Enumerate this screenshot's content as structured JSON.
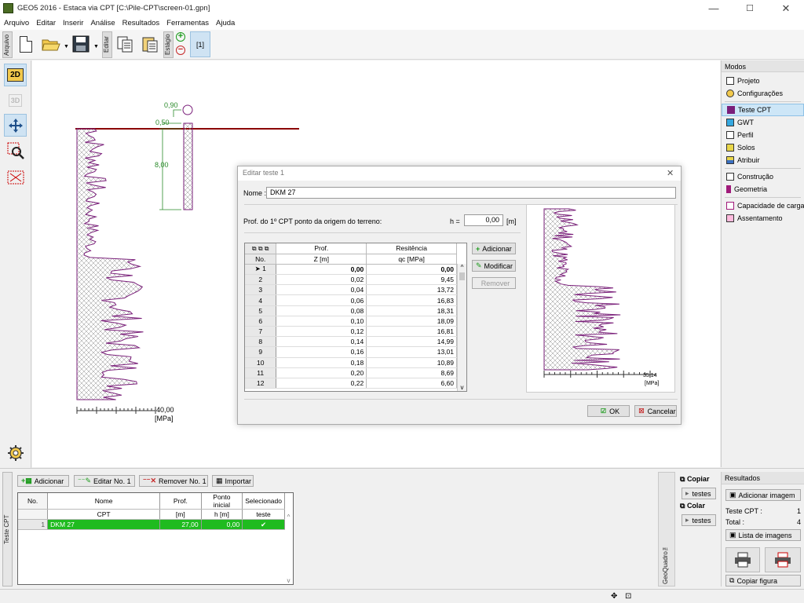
{
  "window": {
    "title": "GEO5 2016 - Estaca via CPT [C:\\Pile-CPT\\screen-01.gpn]",
    "minimize": "—",
    "maximize": "☐",
    "close": "✕"
  },
  "menu": [
    "Arquivo",
    "Editar",
    "Inserir",
    "Análise",
    "Resultados",
    "Ferramentas",
    "Ajuda"
  ],
  "toolbar": {
    "arquivo_tab": "Arquivo",
    "editar_tab": "Editar",
    "estagio_tab": "Estágio",
    "stage": "[1]"
  },
  "leftbar": {
    "btn_2d": "2D",
    "btn_3d": "3D"
  },
  "drawing": {
    "dim_top": "0,90",
    "dim_mid": "0,50",
    "dim_len": "8,00",
    "axis_value": "40,00",
    "axis_unit": "[MPa]"
  },
  "right_panel": {
    "header": "Modos",
    "items": [
      "Projeto",
      "Configurações",
      "Teste CPT",
      "GWT",
      "Perfil",
      "Solos",
      "Atribuir",
      "Construção",
      "Geometria",
      "Capacidade de carga",
      "Assentamento"
    ],
    "active_index": 2
  },
  "dialog": {
    "title": "Editar teste 1",
    "name_label": "Nome :",
    "name_value": "DKM 27",
    "prof_label": "Prof. do 1º CPT ponto da origem do terreno:",
    "h_label": "h =",
    "h_value": "0,00",
    "h_unit": "[m]",
    "col_no": "No.",
    "col_prof": "Prof.",
    "col_prof_unit": "Z [m]",
    "col_res": "Resitência",
    "col_res_unit": "qc [MPa]",
    "rows": [
      [
        "1",
        "0,00",
        "0,00"
      ],
      [
        "2",
        "0,02",
        "9,45"
      ],
      [
        "3",
        "0,04",
        "13,72"
      ],
      [
        "4",
        "0,06",
        "16,83"
      ],
      [
        "5",
        "0,08",
        "18,31"
      ],
      [
        "6",
        "0,10",
        "18,09"
      ],
      [
        "7",
        "0,12",
        "16,81"
      ],
      [
        "8",
        "0,14",
        "14,99"
      ],
      [
        "9",
        "0,16",
        "13,01"
      ],
      [
        "10",
        "0,18",
        "10,89"
      ],
      [
        "11",
        "0,20",
        "8,69"
      ],
      [
        "12",
        "0,22",
        "6,60"
      ]
    ],
    "btn_add": "Adicionar",
    "btn_modify": "Modificar",
    "btn_remove": "Remover",
    "preview_axis_value": "35,14",
    "preview_axis_unit": "[MPa]",
    "ok": "OK",
    "cancel": "Cancelar"
  },
  "bottom": {
    "side_tab": "Teste CPT",
    "btn_add": "Adicionar",
    "btn_edit": "Editar No. 1",
    "btn_remove": "Remover No. 1",
    "btn_import": "Importar",
    "headers": [
      [
        "No.",
        ""
      ],
      [
        "Nome",
        "CPT"
      ],
      [
        "Prof.",
        "[m]"
      ],
      [
        "Ponto inicial",
        "h [m]"
      ],
      [
        "Selecionado",
        "teste"
      ]
    ],
    "rows": [
      {
        "no": "1",
        "name": "DKM 27",
        "prof": "27,00",
        "h": "0,00",
        "selected": "✔"
      }
    ],
    "copy": "Copiar",
    "paste": "Colar",
    "tests": "testes",
    "geoquadro": "GeoQuadro™"
  },
  "results": {
    "header": "Resultados",
    "add_image": "Adicionar imagem",
    "teste_cpt_label": "Teste CPT :",
    "teste_cpt_value": "1",
    "total_label": "Total :",
    "total_value": "4",
    "image_list": "Lista de imagens",
    "copy_figure": "Copiar figura"
  },
  "colors": {
    "accent_green": "#1fbb1f",
    "soil_line": "#8b0000",
    "cpt_purple": "#7a1f7a",
    "active_blue": "#cde6f7"
  }
}
